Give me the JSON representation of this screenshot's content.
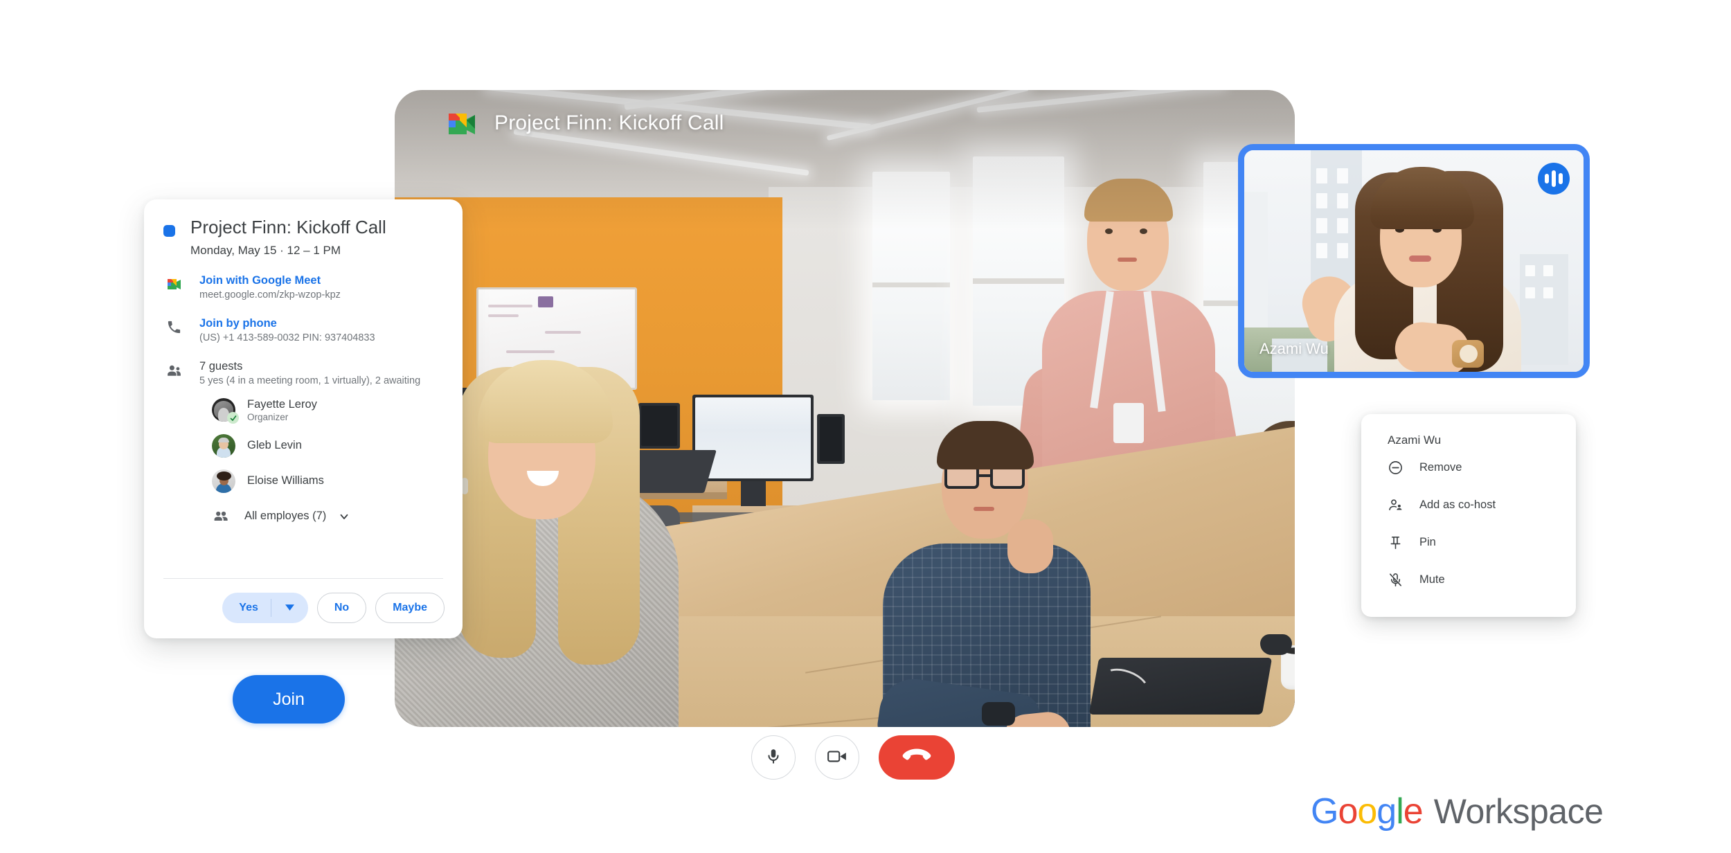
{
  "meet_header": {
    "title": "Project Finn: Kickoff Call",
    "logo_name": "google-meet-logo"
  },
  "speaker_tile": {
    "name": "Azami Wu",
    "speaking_icon": "speaking-indicator-icon",
    "border_color": "#4285f4"
  },
  "event_card": {
    "title": "Project Finn: Kickoff Call",
    "when": "Monday, May 15  ·  12 – 1 PM",
    "color_dot": "#1a73e8",
    "meet": {
      "link_label": "Join with Google Meet",
      "url": "meet.google.com/zkp-wzop-kpz",
      "icon": "google-meet-icon"
    },
    "phone": {
      "link_label": "Join by phone",
      "details": "(US) +1 413-589-0032 PIN: 937404833",
      "icon": "phone-icon"
    },
    "guests": {
      "icon": "people-icon",
      "count_label": "7 guests",
      "summary": "5 yes (4 in a meeting room, 1 virtually), 2 awaiting",
      "list": [
        {
          "name": "Fayette Leroy",
          "role": "Organizer",
          "accepted": true
        },
        {
          "name": "Gleb Levin",
          "role": "",
          "accepted": false
        },
        {
          "name": "Eloise Williams",
          "role": "",
          "accepted": false
        }
      ],
      "group": {
        "label": "All employes (7)",
        "icon": "group-icon",
        "chevron": "chevron-down-icon"
      }
    },
    "rsvp": {
      "yes": "Yes",
      "yes_caret": "caret-down-icon",
      "no": "No",
      "maybe": "Maybe"
    }
  },
  "join_button": {
    "label": "Join"
  },
  "context_menu": {
    "title": "Azami Wu",
    "items": [
      {
        "label": "Remove",
        "icon": "remove-circle-icon"
      },
      {
        "label": "Add as co-host",
        "icon": "person-add-icon"
      },
      {
        "label": "Pin",
        "icon": "pin-icon"
      },
      {
        "label": "Mute",
        "icon": "mic-off-icon"
      }
    ]
  },
  "controls": [
    {
      "name": "microphone",
      "icon": "mic-icon",
      "style": "outline"
    },
    {
      "name": "camera",
      "icon": "video-camera-icon",
      "style": "outline"
    },
    {
      "name": "end-call",
      "icon": "end-call-icon",
      "style": "danger",
      "color": "#ea4335"
    }
  ],
  "brand": {
    "google": [
      {
        "ch": "G",
        "color": "#4285f4"
      },
      {
        "ch": "o",
        "color": "#ea4335"
      },
      {
        "ch": "o",
        "color": "#fbbc05"
      },
      {
        "ch": "g",
        "color": "#4285f4"
      },
      {
        "ch": "l",
        "color": "#34a853"
      },
      {
        "ch": "e",
        "color": "#ea4335"
      }
    ],
    "word": "Workspace",
    "word_color": "#5f6368"
  }
}
